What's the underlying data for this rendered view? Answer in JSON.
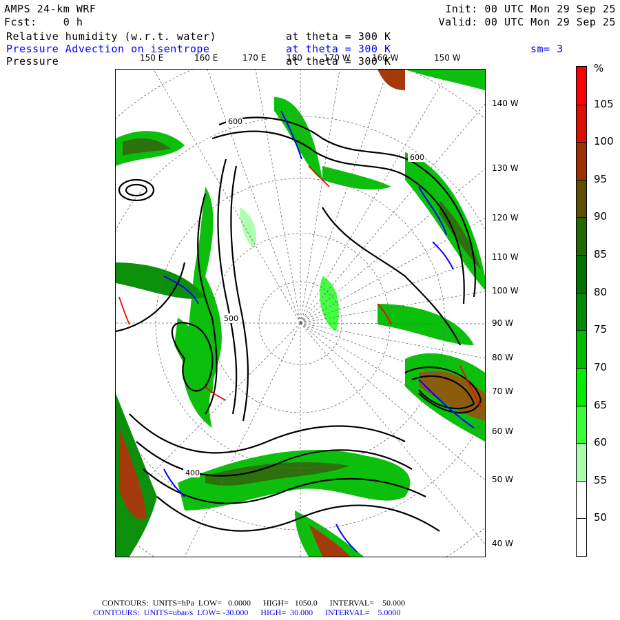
{
  "header": {
    "model": "AMPS 24-km WRF",
    "init": "Init: 00 UTC Mon 29 Sep 25",
    "fcst": "Fcst:    0 h",
    "valid": "Valid: 00 UTC Mon 29 Sep 25",
    "fields": [
      {
        "name": "Relative humidity (w.r.t. water)",
        "level": "at theta = 300 K",
        "color": "#000000"
      },
      {
        "name": "Pressure Advection on isentrope",
        "level": "at theta = 300 K",
        "extra": "sm= 3",
        "color": "#0000ff"
      },
      {
        "name": "Pressure",
        "level": "at theta = 300 K",
        "color": "#000000"
      }
    ]
  },
  "map": {
    "top_lon_labels": [
      "150 E",
      "160 E",
      "170 E",
      "180",
      "170 W",
      "160 W",
      "150 W"
    ],
    "right_lon_labels": [
      "140 W",
      "130 W",
      "120 W",
      "110 W",
      "100 W",
      "90 W",
      "80 W",
      "70 W",
      "60 W",
      "50 W",
      "40 W"
    ],
    "contour_labels": [
      "600",
      "600",
      "500",
      "400"
    ]
  },
  "colorbar": {
    "unit": "%",
    "labels": [
      "105",
      "100",
      "95",
      "90",
      "85",
      "80",
      "75",
      "70",
      "65",
      "60",
      "55",
      "50"
    ],
    "colors": [
      "#ff0000",
      "#dd0f00",
      "#a03000",
      "#5e5000",
      "#226a00",
      "#007300",
      "#008b00",
      "#00bc00",
      "#00ee00",
      "#38ff38",
      "#aaffaa",
      "#ffffff",
      "#ffffff"
    ]
  },
  "footer": {
    "black": {
      "label": "CONTOURS:",
      "units": "UNITS=hPa",
      "low": "LOW=   0.0000",
      "high": "HIGH=   1050.0",
      "interval": "INTERVAL=    50.000"
    },
    "blue": {
      "label": "CONTOURS:",
      "units": "UNITS=ubar/s",
      "low": "LOW= -30.000",
      "high": "HIGH=  30.000",
      "interval": "INTERVAL=    5.0000"
    }
  }
}
